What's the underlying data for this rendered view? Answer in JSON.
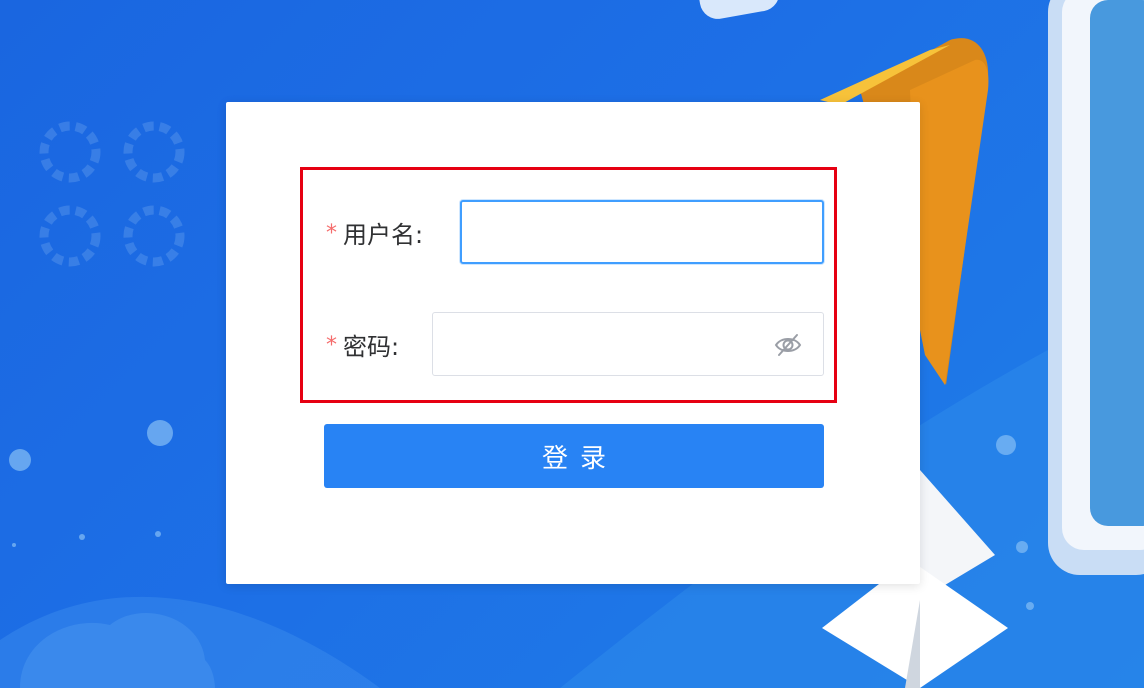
{
  "login_form": {
    "username_label": "用户名:",
    "password_label": "密码:",
    "required_mark": "*",
    "username_value": "",
    "password_value": "",
    "submit_label": "登录"
  },
  "icons": {
    "password_toggle": "eye-hidden-icon"
  },
  "colors": {
    "background": "#1d6fe6",
    "card": "#ffffff",
    "primary_button": "#2883f4",
    "focus_border": "#409eff",
    "required_star": "#f56c6c",
    "highlight_box": "#e60012",
    "accent_orange": "#f0a020"
  }
}
